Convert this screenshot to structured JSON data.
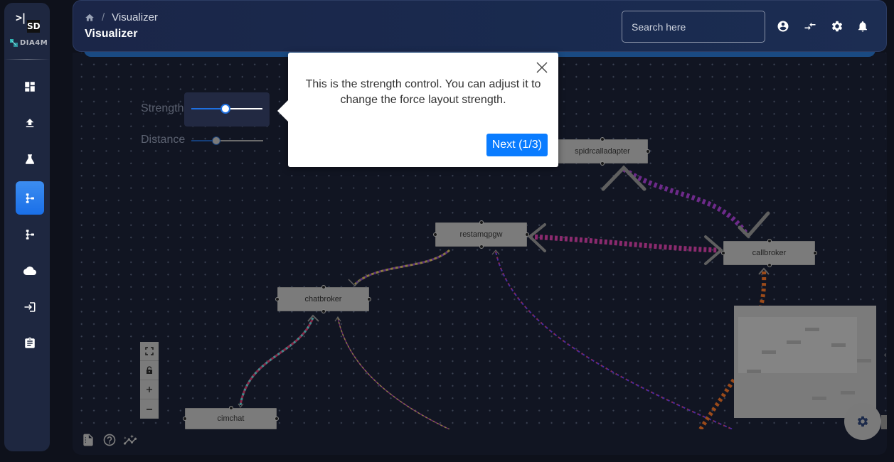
{
  "sidebar": {
    "logo_toggle": ">|",
    "logo_mark": "SD",
    "brand": "DIA4M",
    "items": [
      {
        "name": "dashboard",
        "icon": "dashboard-icon",
        "active": false
      },
      {
        "name": "upload",
        "icon": "upload-icon",
        "active": false
      },
      {
        "name": "lab",
        "icon": "flask-icon",
        "active": false
      },
      {
        "name": "visualizer",
        "icon": "tree-icon",
        "active": true
      },
      {
        "name": "topology",
        "icon": "tree-icon",
        "active": false
      },
      {
        "name": "cloud",
        "icon": "cloud-icon",
        "active": false
      },
      {
        "name": "login",
        "icon": "login-icon",
        "active": false
      },
      {
        "name": "clipboard",
        "icon": "clipboard-icon",
        "active": false
      }
    ]
  },
  "header": {
    "breadcrumb_sep": "/",
    "breadcrumb_current": "Visualizer",
    "title": "Visualizer",
    "search_placeholder": "Search here",
    "icons": [
      "account-icon",
      "compare-arrows-icon",
      "settings-icon",
      "notifications-icon"
    ]
  },
  "controls": {
    "strength_label": "Strength",
    "strength_value": 0.5,
    "distance_label": "Distance",
    "distance_value": 0.35
  },
  "tour": {
    "text": "This is the strength control. You can adjust it to change the force layout strength.",
    "next_label": "Next (1/3)",
    "step": 1,
    "total": 3
  },
  "graph": {
    "nodes": [
      {
        "id": "spidrcalladapter",
        "label": "spidrcalladapter"
      },
      {
        "id": "restamqpgw",
        "label": "restamqpgw"
      },
      {
        "id": "callbroker",
        "label": "callbroker"
      },
      {
        "id": "chatbroker",
        "label": "chatbroker"
      },
      {
        "id": "cimchat",
        "label": "cimchat"
      }
    ],
    "edges": [
      {
        "from": "callbroker",
        "to": "spidrcalladapter",
        "colors": [
          "#6d2a8a",
          "#555555"
        ]
      },
      {
        "from": "restamqpgw",
        "to": "callbroker",
        "colors": [
          "#8b2a6e",
          "#5a2a6e"
        ]
      },
      {
        "from": "restamqpgw",
        "to": "chatbroker",
        "colors": [
          "#8a7a40",
          "#5a2d7e"
        ]
      },
      {
        "from": "chatbroker",
        "to": "cimchat",
        "colors": [
          "#3f8c8c",
          "#8a2a4a"
        ]
      },
      {
        "from": "offscreen",
        "to": "chatbroker",
        "colors": [
          "#8a7a40",
          "#6d2a6d"
        ]
      },
      {
        "from": "offscreen",
        "to": "restamqpgw",
        "colors": [
          "#4a2aa0",
          "#8a2a4a"
        ]
      },
      {
        "from": "offscreen",
        "to": "callbroker",
        "colors": [
          "#9a4a1a",
          "#3a8a5a"
        ]
      }
    ]
  },
  "zoom_controls": [
    "fit-view-icon",
    "lock-icon",
    "zoom-in-icon",
    "zoom-out-icon"
  ],
  "footer_icons": [
    "document-icon",
    "help-icon",
    "insights-icon"
  ],
  "fab": "settings-icon"
}
